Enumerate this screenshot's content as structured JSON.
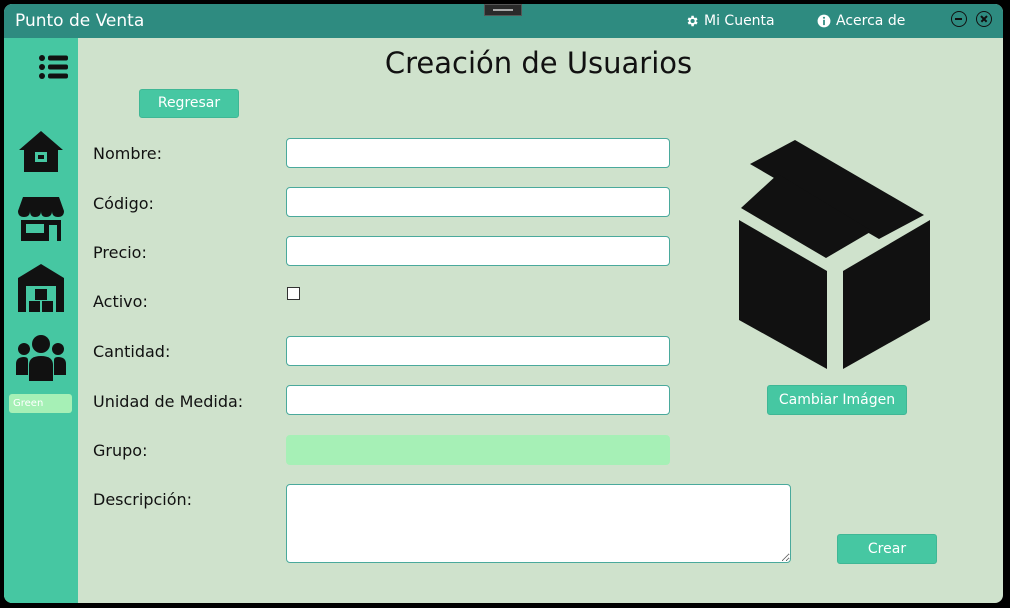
{
  "titlebar": {
    "app_title": "Punto de Venta",
    "account_label": "Mi Cuenta",
    "about_label": "Acerca de"
  },
  "sidebar": {
    "icons": [
      "menu-icon",
      "home-icon",
      "store-icon",
      "warehouse-icon",
      "users-icon"
    ],
    "theme_value": "Green"
  },
  "page": {
    "title": "Creación de Usuarios",
    "back_button": "Regresar"
  },
  "form": {
    "nombre": {
      "label": "Nombre:",
      "value": ""
    },
    "codigo": {
      "label": "Código:",
      "value": ""
    },
    "precio": {
      "label": "Precio:",
      "value": ""
    },
    "activo": {
      "label": "Activo:",
      "checked": false
    },
    "cantidad": {
      "label": "Cantidad:",
      "value": ""
    },
    "unidad": {
      "label": "Unidad de Medida:",
      "value": ""
    },
    "grupo": {
      "label": "Grupo:",
      "value": ""
    },
    "descripcion": {
      "label": "Descripción:",
      "value": ""
    }
  },
  "image_panel": {
    "icon": "box-icon",
    "change_button": "Cambiar Imágen"
  },
  "actions": {
    "create_button": "Crear"
  },
  "colors": {
    "titlebar": "#2e8b80",
    "sidebar": "#46c7a2",
    "background": "#cfe2cc",
    "accent_field": "#a6f0b6"
  }
}
